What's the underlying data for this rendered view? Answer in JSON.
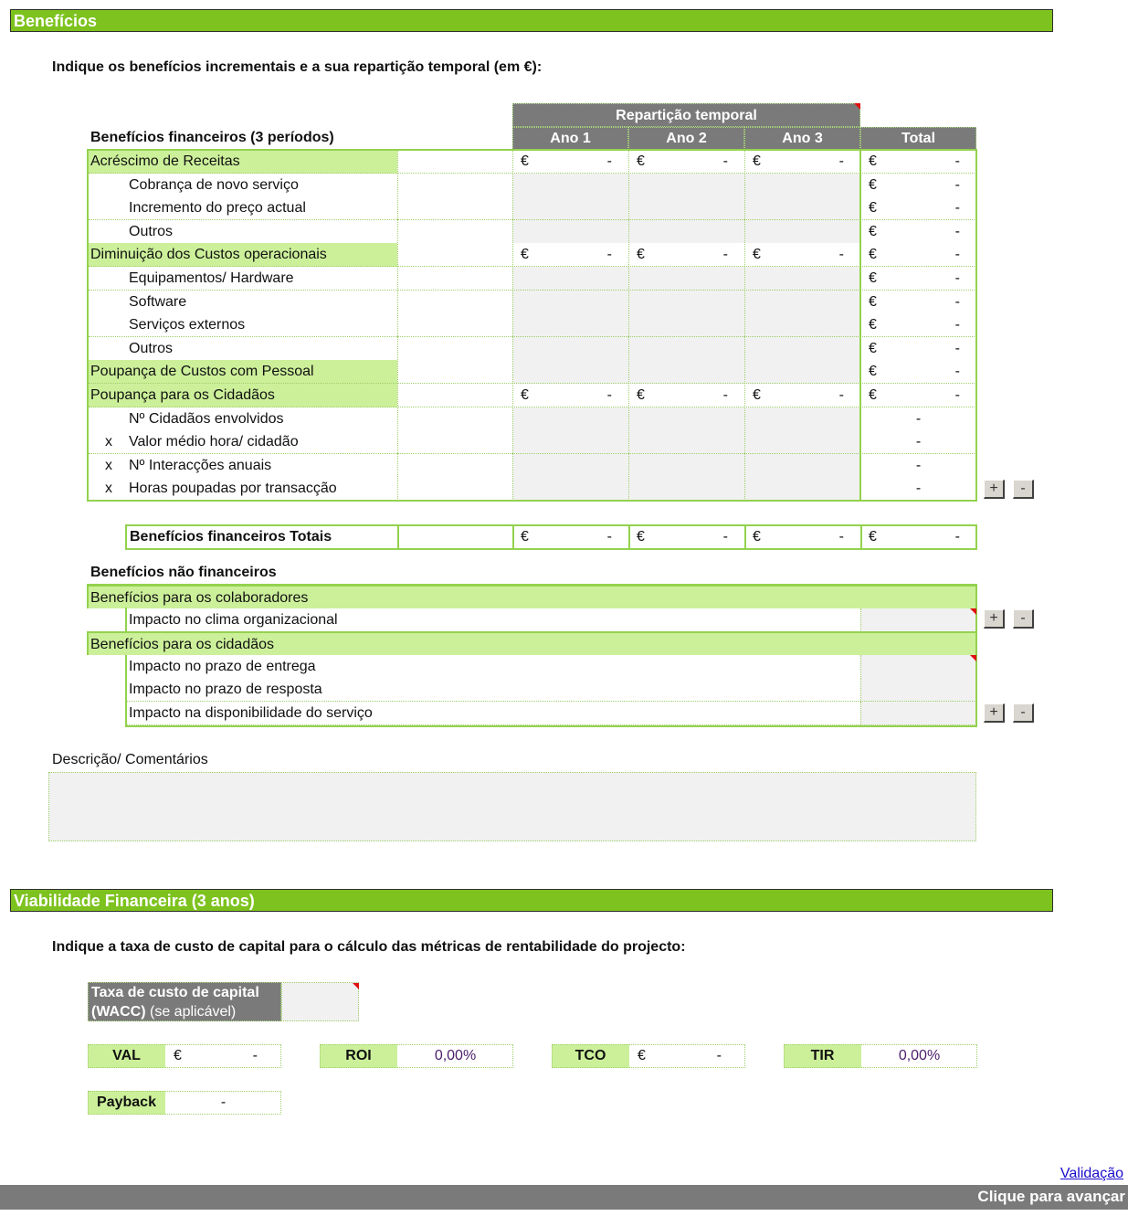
{
  "beneficios_section": {
    "title": "Benefícios",
    "instruction": "Indique os benefícios incrementais e a sua repartição temporal (em €):",
    "table_title": "Benefícios financeiros (3 períodos)",
    "header_group": "Repartição temporal",
    "columns": [
      "Ano 1",
      "Ano 2",
      "Ano 3",
      "Total"
    ],
    "currency_symbol": "€",
    "empty_value": "-",
    "rows": [
      {
        "prefix": "",
        "label": "Acréscimo de Receitas"
      },
      {
        "prefix": "",
        "label": "Cobrança de novo serviço"
      },
      {
        "prefix": "",
        "label": "Incremento do preço actual"
      },
      {
        "prefix": "",
        "label": "Outros"
      },
      {
        "prefix": "",
        "label": "Diminuição dos Custos operacionais"
      },
      {
        "prefix": "",
        "label": "Equipamentos/ Hardware"
      },
      {
        "prefix": "",
        "label": "Software"
      },
      {
        "prefix": "",
        "label": "Serviços externos"
      },
      {
        "prefix": "",
        "label": "Outros"
      },
      {
        "prefix": "",
        "label": "Poupança de Custos com Pessoal"
      },
      {
        "prefix": "",
        "label": "Poupança para os Cidadãos"
      },
      {
        "prefix": "",
        "label": "Nº Cidadãos envolvidos"
      },
      {
        "prefix": "x",
        "label": "Valor médio hora/ cidadão"
      },
      {
        "prefix": "x",
        "label": "Nº Interacções anuais"
      },
      {
        "prefix": "x",
        "label": "Horas poupadas por transacção"
      }
    ],
    "totals_label": "Benefícios financeiros Totais",
    "add_button": "+",
    "remove_button": "-",
    "non_financial_title": "Benefícios não financeiros",
    "non_financial": [
      {
        "type": "category",
        "label": "Benefícios para os colaboradores"
      },
      {
        "type": "item",
        "label": "Impacto no clima organizacional"
      },
      {
        "type": "category",
        "label": "Benefícios para os cidadãos"
      },
      {
        "type": "item",
        "label": "Impacto no prazo de entrega"
      },
      {
        "type": "item",
        "label": "Impacto no prazo de resposta"
      },
      {
        "type": "item",
        "label": "Impacto na disponibilidade do serviço"
      }
    ],
    "comments_label": "Descrição/ Comentários",
    "comments_value": ""
  },
  "viabilidade_section": {
    "title": "Viabilidade Financeira (3 anos)",
    "instruction": "Indique a taxa de custo de capital para o cálculo das métricas de rentabilidade do projecto:",
    "wacc_label_bold": "Taxa de custo de capital",
    "wacc_label_bold2": "(WACC)",
    "wacc_label_normal": " (se aplicável)",
    "wacc_value": "",
    "metrics": [
      {
        "label": "VAL",
        "currency": "€",
        "value": "-"
      },
      {
        "label": "ROI",
        "currency": "",
        "value": "0,00%"
      },
      {
        "label": "TCO",
        "currency": "€",
        "value": "-"
      },
      {
        "label": "TIR",
        "currency": "",
        "value": "0,00%"
      },
      {
        "label": "Payback",
        "currency": "",
        "value": "-"
      }
    ]
  },
  "footer": {
    "validation_link": "Validação",
    "next_label": "Clique para avançar"
  },
  "colors": {
    "section_green": "#7dc21e",
    "category_green": "#ccf09a",
    "header_grey": "#7a7a7a",
    "input_grey": "#f1f1f1",
    "border_green": "#93d24e"
  }
}
